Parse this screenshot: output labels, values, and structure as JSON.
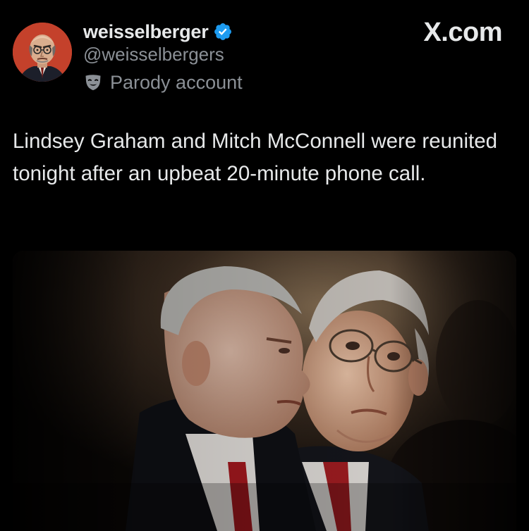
{
  "post": {
    "author": {
      "display_name": "weisselberger",
      "handle": "@weisselbergers",
      "verified": true,
      "account_label": "Parody account",
      "avatar_icon": "cartoon-portrait-avatar",
      "badge_icon": "verified-badge-icon",
      "label_icon": "theater-mask-icon"
    },
    "brand": "X.com",
    "text": "Lindsey Graham and Mitch McConnell were reunited tonight after an upbeat 20-minute phone call.",
    "media": {
      "kind": "photo",
      "subject": "two men in dark suits, foreground man in profile, background man in glasses looking toward him"
    }
  },
  "colors": {
    "background": "#000000",
    "primary_text": "#e7e9ea",
    "secondary_text": "#8b9096",
    "verified_blue": "#1d9bf0",
    "avatar_bg": "#c4412b"
  }
}
